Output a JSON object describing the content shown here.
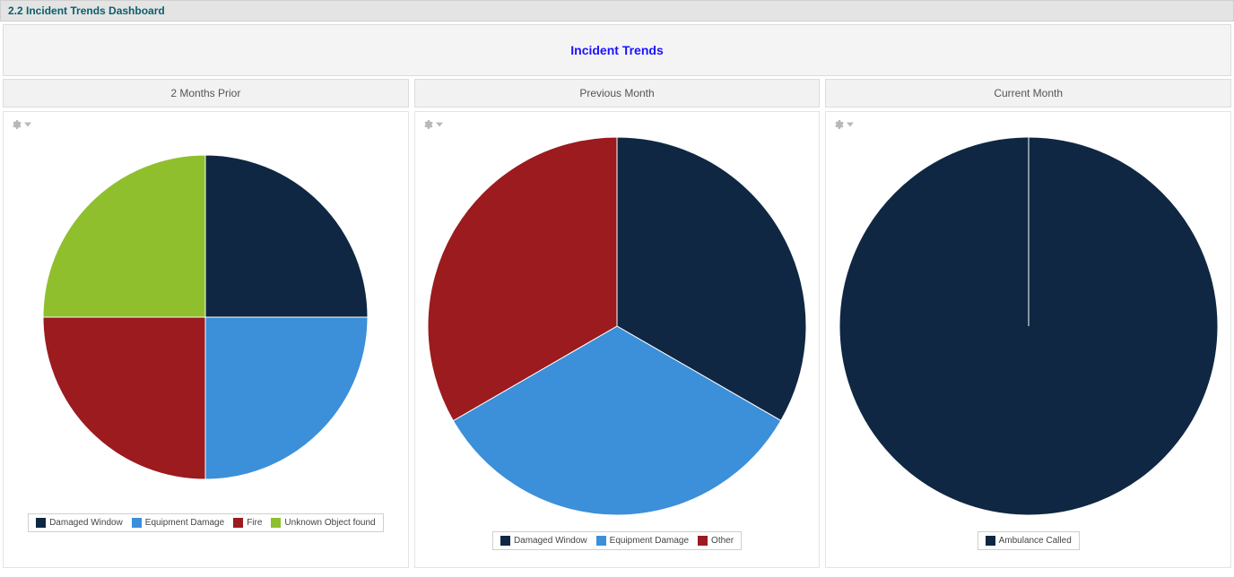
{
  "title_bar": "2.2 Incident Trends Dashboard",
  "header_title": "Incident Trends",
  "periods": {
    "a": "2 Months Prior",
    "b": "Previous Month",
    "c": "Current Month"
  },
  "palette": {
    "damaged_window": "#0f2742",
    "equipment_damage": "#3c8fd9",
    "fire": "#9b1b1f",
    "unknown_object_found": "#8fbf2d",
    "other": "#9b1b1f",
    "ambulance_called": "#0f2742"
  },
  "legend_labels": {
    "damaged_window": "Damaged Window",
    "equipment_damage": "Equipment Damage",
    "fire": "Fire",
    "unknown_object_found": "Unknown Object found",
    "other": "Other",
    "ambulance_called": "Ambulance Called"
  },
  "chart_data": [
    {
      "id": "two_months_prior",
      "type": "pie",
      "title": "2 Months Prior",
      "slices": [
        {
          "label": "Damaged Window",
          "value": 25,
          "color_key": "damaged_window"
        },
        {
          "label": "Equipment Damage",
          "value": 25,
          "color_key": "equipment_damage"
        },
        {
          "label": "Fire",
          "value": 25,
          "color_key": "fire"
        },
        {
          "label": "Unknown Object found",
          "value": 25,
          "color_key": "unknown_object_found"
        }
      ]
    },
    {
      "id": "previous_month",
      "type": "pie",
      "title": "Previous Month",
      "slices": [
        {
          "label": "Damaged Window",
          "value": 33.33,
          "color_key": "damaged_window"
        },
        {
          "label": "Equipment Damage",
          "value": 33.33,
          "color_key": "equipment_damage"
        },
        {
          "label": "Other",
          "value": 33.34,
          "color_key": "other"
        }
      ]
    },
    {
      "id": "current_month",
      "type": "pie",
      "title": "Current Month",
      "slices": [
        {
          "label": "Ambulance Called",
          "value": 100,
          "color_key": "ambulance_called"
        }
      ]
    }
  ]
}
